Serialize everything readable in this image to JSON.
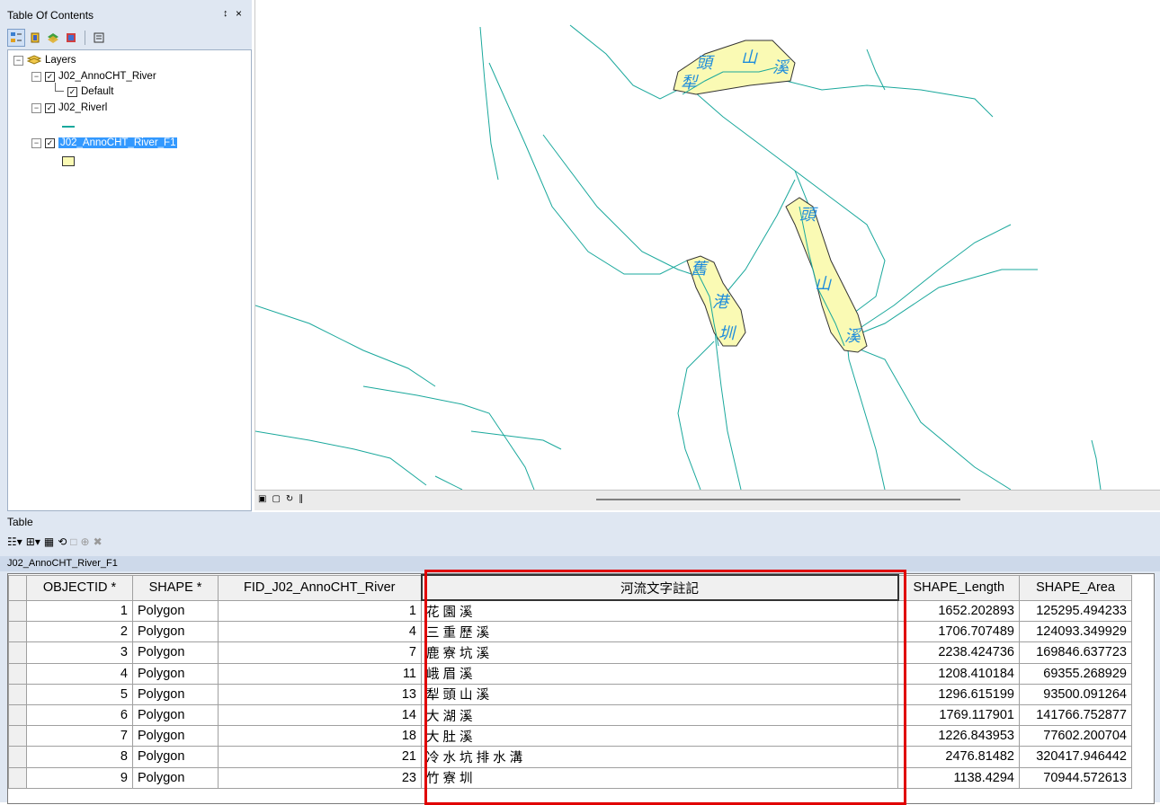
{
  "toc": {
    "title": "Table Of Contents",
    "pin_glyph": "↕",
    "close_glyph": "×",
    "layers_label": "Layers",
    "layer1": "J02_AnnoCHT_River",
    "layer1_sub": "Default",
    "layer2": "J02_Riverl",
    "layer3": "J02_AnnoCHT_River_F1"
  },
  "map": {
    "river_color": "#1aa89c",
    "poly_fill": "#fafab4",
    "label_color": "#1e8cdc",
    "labels": {
      "a1": "頭",
      "a2": "山",
      "a3": "溪",
      "a4": "犁",
      "b1": "頭",
      "b2": "山",
      "b3": "溪",
      "c1": "舊",
      "c2": "港",
      "c3": "圳"
    }
  },
  "table": {
    "window_title": "Table",
    "tab_label": "J02_AnnoCHT_River_F1",
    "columns": [
      "OBJECTID *",
      "SHAPE *",
      "FID_J02_AnnoCHT_River",
      "河流文字註記",
      "SHAPE_Length",
      "SHAPE_Area"
    ],
    "rows": [
      [
        "1",
        "Polygon",
        "1",
        "花 園 溪",
        "1652.202893",
        "125295.494233"
      ],
      [
        "2",
        "Polygon",
        "4",
        "三 重 歷 溪",
        "1706.707489",
        "124093.349929"
      ],
      [
        "3",
        "Polygon",
        "7",
        "鹿 寮 坑 溪",
        "2238.424736",
        "169846.637723"
      ],
      [
        "4",
        "Polygon",
        "11",
        "峨 眉 溪",
        "1208.410184",
        "69355.268929"
      ],
      [
        "5",
        "Polygon",
        "13",
        "犁 頭 山 溪",
        "1296.615199",
        "93500.091264"
      ],
      [
        "6",
        "Polygon",
        "14",
        "大 湖 溪",
        "1769.117901",
        "141766.752877"
      ],
      [
        "7",
        "Polygon",
        "18",
        "大 肚 溪",
        "1226.843953",
        "77602.200704"
      ],
      [
        "8",
        "Polygon",
        "21",
        "冷 水 坑 排 水 溝",
        "2476.81482",
        "320417.946442"
      ],
      [
        "9",
        "Polygon",
        "23",
        "竹 寮 圳",
        "1138.4294",
        "70944.572613"
      ]
    ]
  }
}
